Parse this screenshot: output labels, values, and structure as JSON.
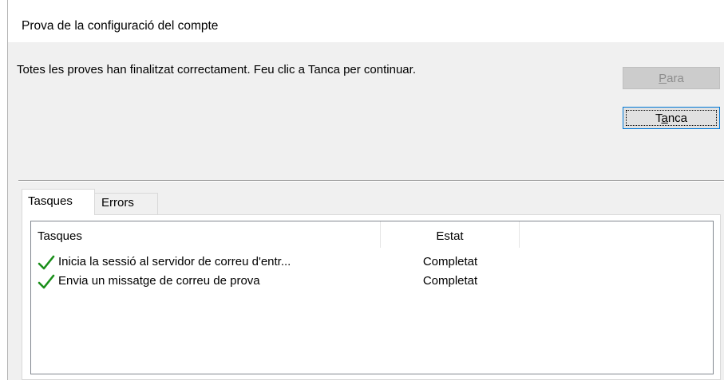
{
  "dialog": {
    "title": "Prova de la configuració del compte",
    "message": "Totes les proves han finalitzat correctament. Feu clic a Tanca per continuar.",
    "buttons": {
      "stop": {
        "label_pre": "",
        "mnemonic": "P",
        "label_post": "ara",
        "enabled": false
      },
      "close": {
        "label_pre": "T",
        "mnemonic": "a",
        "label_post": "nca",
        "enabled": true
      }
    },
    "tabs": [
      {
        "label": "Tasques",
        "selected": true
      },
      {
        "label": "Errors",
        "selected": false
      }
    ],
    "list": {
      "columns": [
        "Tasques",
        "Estat",
        ""
      ],
      "rows": [
        {
          "icon": "green-checkmark-icon",
          "task": "Inicia la sessió al servidor de correu d'entr...",
          "status": "Completat"
        },
        {
          "icon": "green-checkmark-icon",
          "task": "Envia un missatge de correu de prova",
          "status": "Completat"
        }
      ]
    },
    "colors": {
      "check_green": "#1a8f1a",
      "focus_blue": "#0078d7"
    }
  }
}
